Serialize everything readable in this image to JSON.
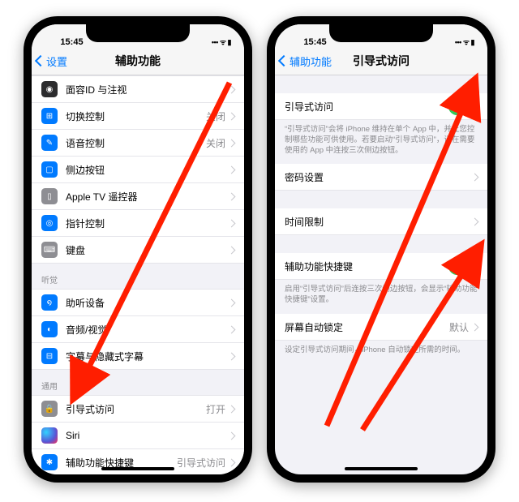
{
  "status": {
    "time": "15:45",
    "indicators": "••• ᯤ ▮"
  },
  "left": {
    "back": "设置",
    "title": "辅助功能",
    "group1": [
      {
        "icon": "face-id-icon",
        "cls": "ic-dark",
        "glyph": "◉",
        "label": "面容ID 与注视"
      },
      {
        "icon": "switch-icon",
        "cls": "ic-blue",
        "glyph": "⊞",
        "label": "切换控制",
        "value": "关闭"
      },
      {
        "icon": "voice-icon",
        "cls": "ic-blue",
        "glyph": "✎",
        "label": "语音控制",
        "value": "关闭"
      },
      {
        "icon": "side-btn-icon",
        "cls": "ic-blue",
        "glyph": "▢",
        "label": "侧边按钮"
      },
      {
        "icon": "tv-remote-icon",
        "cls": "ic-gray",
        "glyph": "▯",
        "label": "Apple TV 遥控器"
      },
      {
        "icon": "pointer-icon",
        "cls": "ic-blue",
        "glyph": "◎",
        "label": "指针控制"
      },
      {
        "icon": "keyboard-icon",
        "cls": "ic-gray",
        "glyph": "⌨",
        "label": "键盘"
      }
    ],
    "hearing_header": "听觉",
    "group2": [
      {
        "icon": "hearing-icon",
        "cls": "ic-blue",
        "glyph": "໑",
        "label": "助听设备"
      },
      {
        "icon": "audio-icon",
        "cls": "ic-blue",
        "glyph": "◐",
        "label": "音频/视觉"
      },
      {
        "icon": "captions-icon",
        "cls": "ic-blue",
        "glyph": "⊟",
        "label": "字幕与隐藏式字幕"
      }
    ],
    "general_header": "通用",
    "group3": [
      {
        "icon": "guided-icon",
        "cls": "ic-gray",
        "glyph": "🔒",
        "label": "引导式访问",
        "value": "打开"
      },
      {
        "icon": "siri-icon",
        "cls": "ic-siri",
        "glyph": "",
        "label": "Siri"
      },
      {
        "icon": "shortcut-icon",
        "cls": "ic-blue",
        "glyph": "✱",
        "label": "辅助功能快捷键",
        "value": "引导式访问"
      }
    ]
  },
  "right": {
    "back": "辅助功能",
    "title": "引导式访问",
    "section1": {
      "label": "引导式访问",
      "footer": "“引导式访问”会将 iPhone 维持在单个 App 中，并让您控制哪些功能可供使用。若要启动“引导式访问”，请在需要使用的 App 中连按三次侧边按钮。"
    },
    "section2": [
      {
        "label": "密码设置"
      },
      {
        "label": "时间限制"
      }
    ],
    "section3": {
      "label": "辅助功能快捷键",
      "footer": "启用“引导式访问”后连按三次侧边按钮，会显示“辅助功能快捷键”设置。"
    },
    "section4": {
      "label": "屏幕自动锁定",
      "value": "默认",
      "footer": "设定引导式访问期间，iPhone 自动锁定所需的时间。"
    }
  }
}
